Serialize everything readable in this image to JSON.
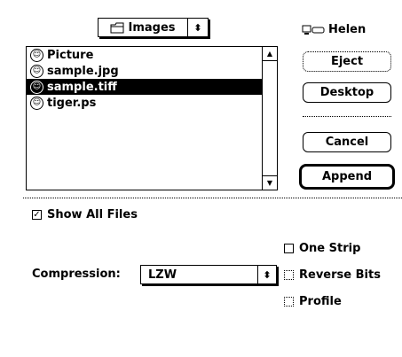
{
  "folder_popup": {
    "label": "Images",
    "icon": "folder-icon",
    "arrows": "⬍"
  },
  "volume": {
    "label": "Helen",
    "icon": "computer-drive-icon"
  },
  "files": [
    {
      "name": "Picture",
      "selected": false,
      "icon": "file-icon"
    },
    {
      "name": "sample.jpg",
      "selected": false,
      "icon": "file-icon"
    },
    {
      "name": "sample.tiff",
      "selected": true,
      "icon": "file-icon"
    },
    {
      "name": "tiger.ps",
      "selected": false,
      "icon": "file-icon"
    }
  ],
  "buttons": {
    "eject": "Eject",
    "desktop": "Desktop",
    "cancel": "Cancel",
    "append": "Append"
  },
  "show_all_files": {
    "label": "Show All Files",
    "checked": true
  },
  "compression": {
    "label": "Compression:",
    "value": "LZW"
  },
  "options": [
    {
      "label": "One Strip",
      "checked": false,
      "enabled": true
    },
    {
      "label": "Reverse Bits",
      "checked": false,
      "enabled": false
    },
    {
      "label": "Profile",
      "checked": false,
      "enabled": false
    }
  ]
}
